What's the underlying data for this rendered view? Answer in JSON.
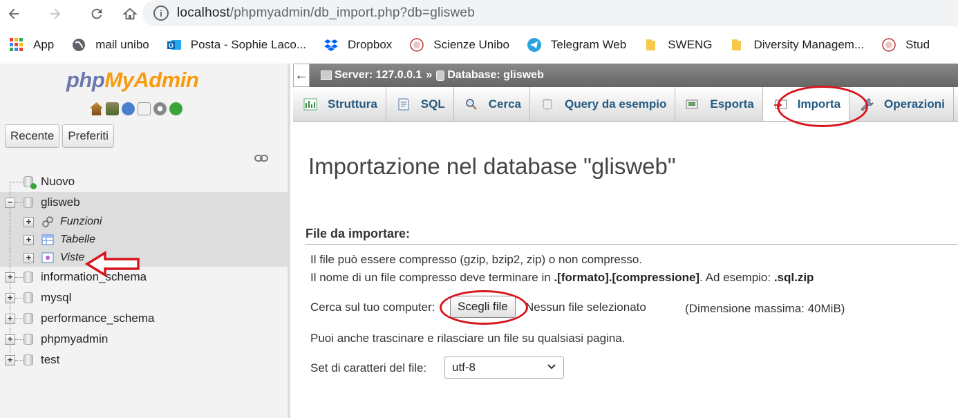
{
  "browser": {
    "url_host": "localhost",
    "url_path": "/phpmyadmin/db_import.php?db=glisweb",
    "bookmarks": [
      {
        "label": "App",
        "icon": "apps-grid-icon"
      },
      {
        "label": "mail unibo",
        "icon": "globe-icon"
      },
      {
        "label": "Posta - Sophie Laco...",
        "icon": "outlook-icon"
      },
      {
        "label": "Dropbox",
        "icon": "dropbox-icon"
      },
      {
        "label": "Scienze Unibo",
        "icon": "unibo-seal-icon"
      },
      {
        "label": "Telegram Web",
        "icon": "telegram-icon"
      },
      {
        "label": "SWENG",
        "icon": "folder-icon"
      },
      {
        "label": "Diversity Managem...",
        "icon": "folder-icon"
      },
      {
        "label": "Stud",
        "icon": "unibo-seal-icon"
      }
    ]
  },
  "nav": {
    "logo_php": "php",
    "logo_myadmin": "MyAdmin",
    "recent_label": "Recente",
    "favorites_label": "Preferiti",
    "tree": {
      "new_label": "Nuovo",
      "selected_db": "glisweb",
      "sub_items": [
        "Funzioni",
        "Tabelle",
        "Viste"
      ],
      "databases": [
        "information_schema",
        "mysql",
        "performance_schema",
        "phpmyadmin",
        "test"
      ]
    }
  },
  "main": {
    "breadcrumb_server": "Server: 127.0.0.1",
    "breadcrumb_sep": "»",
    "breadcrumb_db": "Database: glisweb",
    "tabs": [
      {
        "label": "Struttura",
        "icon": "structure-icon"
      },
      {
        "label": "SQL",
        "icon": "sql-icon"
      },
      {
        "label": "Cerca",
        "icon": "search-icon"
      },
      {
        "label": "Query da esempio",
        "icon": "query-icon"
      },
      {
        "label": "Esporta",
        "icon": "export-icon"
      },
      {
        "label": "Importa",
        "icon": "import-icon",
        "active": true
      },
      {
        "label": "Operazioni",
        "icon": "wrench-icon"
      }
    ],
    "page_title": "Importazione nel database \"glisweb\"",
    "section_title": "File da importare:",
    "compress_note": "Il file può essere compresso (gzip, bzip2, zip) o non compresso.",
    "name_note_prefix": "Il nome di un file compresso deve terminare in ",
    "name_note_format": ".[formato].[compressione]",
    "name_note_mid": ". Ad esempio: ",
    "name_note_example": ".sql.zip",
    "browse_label": "Cerca sul tuo computer:",
    "choose_file_button": "Scegli file",
    "no_file_text": "Nessun file selezionato",
    "max_size": "(Dimensione massima: 40MiB)",
    "drag_note": "Puoi anche trascinare e rilasciare un file su qualsiasi pagina.",
    "charset_label": "Set di caratteri del file:",
    "charset_value": "utf-8"
  },
  "colors": {
    "annotation_red": "#d8141c",
    "tab_text": "#235a81",
    "logo_php": "#6c78af",
    "logo_myadmin": "#f89c0e"
  }
}
